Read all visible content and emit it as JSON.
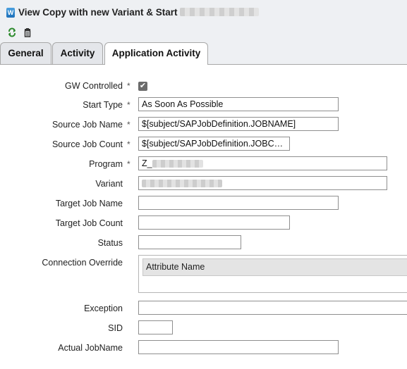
{
  "window": {
    "title": "View Copy with new Variant & Start"
  },
  "toolbar": {
    "icons": [
      "refresh-icon",
      "delete-icon"
    ]
  },
  "tabs": [
    {
      "label": "General",
      "active": false
    },
    {
      "label": "Activity",
      "active": false
    },
    {
      "label": "Application Activity",
      "active": true
    }
  ],
  "form": {
    "required_mark": "*",
    "gw_controlled": {
      "label": "GW Controlled",
      "checked": true
    },
    "start_type": {
      "label": "Start Type",
      "value": "As Soon As Possible"
    },
    "source_job_name": {
      "label": "Source Job Name",
      "value": "$[subject/SAPJobDefinition.JOBNAME]"
    },
    "source_job_count": {
      "label": "Source Job Count",
      "value": "$[subject/SAPJobDefinition.JOBCOUNT]"
    },
    "program": {
      "label": "Program",
      "value": "Z_"
    },
    "variant": {
      "label": "Variant",
      "value": ""
    },
    "target_job_name": {
      "label": "Target Job Name",
      "value": ""
    },
    "target_job_count": {
      "label": "Target Job Count",
      "value": ""
    },
    "status": {
      "label": "Status",
      "value": ""
    },
    "connection_override": {
      "label": "Connection Override",
      "column": "Attribute Name"
    },
    "exception": {
      "label": "Exception",
      "value": ""
    },
    "sid": {
      "label": "SID",
      "value": ""
    },
    "actual_jobname": {
      "label": "Actual JobName",
      "value": ""
    }
  }
}
